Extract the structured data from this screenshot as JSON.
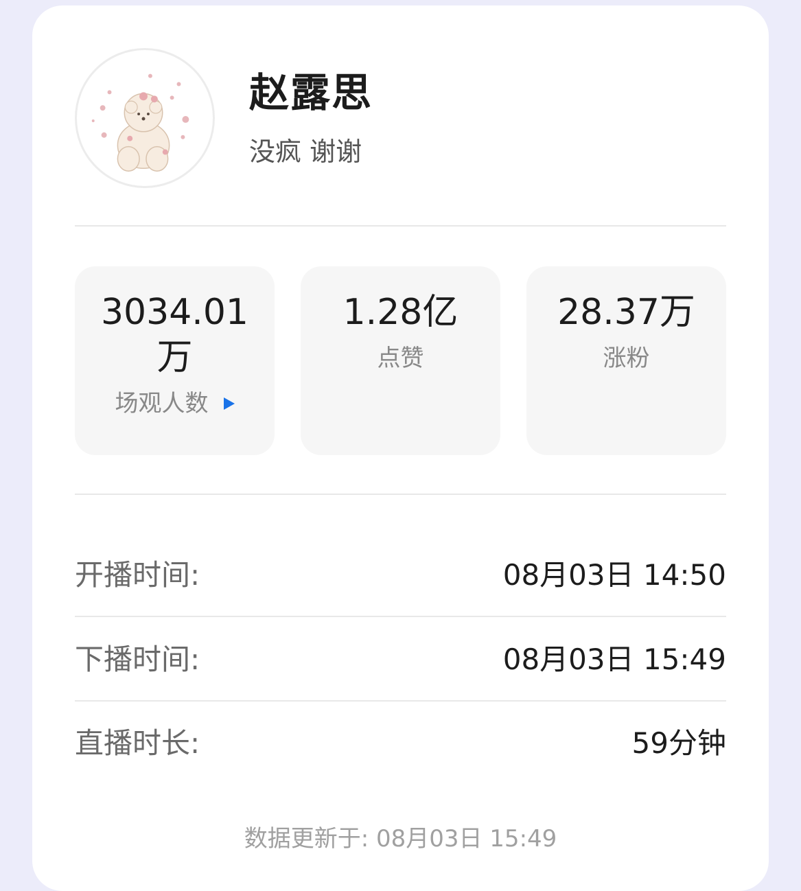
{
  "profile": {
    "name": "赵露思",
    "bio": "没疯 谢谢",
    "avatar": "cartoon-puppy-avatar"
  },
  "stats": [
    {
      "value": "3034.01万",
      "label": "场观人数",
      "has_arrow": true
    },
    {
      "value": "1.28亿",
      "label": "点赞",
      "has_arrow": false
    },
    {
      "value": "28.37万",
      "label": "涨粉",
      "has_arrow": false
    }
  ],
  "details": [
    {
      "label": "开播时间:",
      "value": "08月03日 14:50"
    },
    {
      "label": "下播时间:",
      "value": "08月03日 15:49"
    },
    {
      "label": "直播时长:",
      "value": "59分钟"
    }
  ],
  "footer": {
    "updated": "数据更新于: 08月03日 15:49"
  },
  "colors": {
    "background": "#ececfa",
    "card": "#ffffff",
    "stat_box": "#f6f6f6",
    "accent_arrow": "#1a73e8"
  }
}
